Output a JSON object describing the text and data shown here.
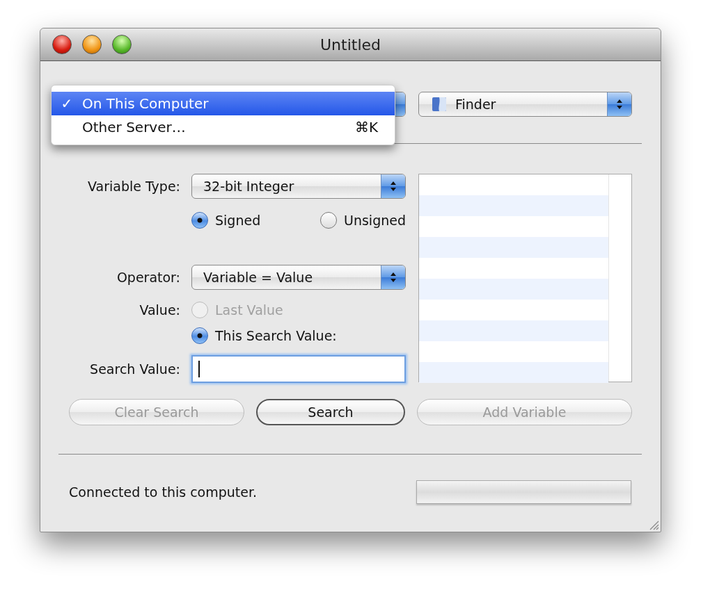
{
  "window": {
    "title": "Untitled"
  },
  "target_menu": {
    "check_mark": "✓",
    "items": [
      {
        "label": "On This Computer",
        "selected": true
      },
      {
        "label": "Other Server…",
        "shortcut": "⌘K",
        "selected": false
      }
    ]
  },
  "process_popup": {
    "value": "Finder"
  },
  "variable_type": {
    "label": "Variable Type:",
    "value": "32-bit Integer"
  },
  "sign_options": [
    {
      "label": "Signed",
      "selected": true,
      "disabled": false
    },
    {
      "label": "Unsigned",
      "selected": false,
      "disabled": false
    }
  ],
  "operator": {
    "label": "Operator:",
    "value": "Variable = Value"
  },
  "value": {
    "label": "Value:",
    "options": [
      {
        "label": "Last Value",
        "selected": false,
        "disabled": true
      },
      {
        "label": "This Search Value:",
        "selected": true,
        "disabled": false
      }
    ]
  },
  "search_value": {
    "label": "Search Value:",
    "focused": true
  },
  "buttons": [
    {
      "label": "Clear Search",
      "disabled": true,
      "default": false
    },
    {
      "label": "Search",
      "disabled": false,
      "default": true
    },
    {
      "label": "Add Variable",
      "disabled": true,
      "default": false
    }
  ],
  "status_bar": {
    "text": "Connected to this computer.",
    "progress": {
      "level": 0
    }
  }
}
